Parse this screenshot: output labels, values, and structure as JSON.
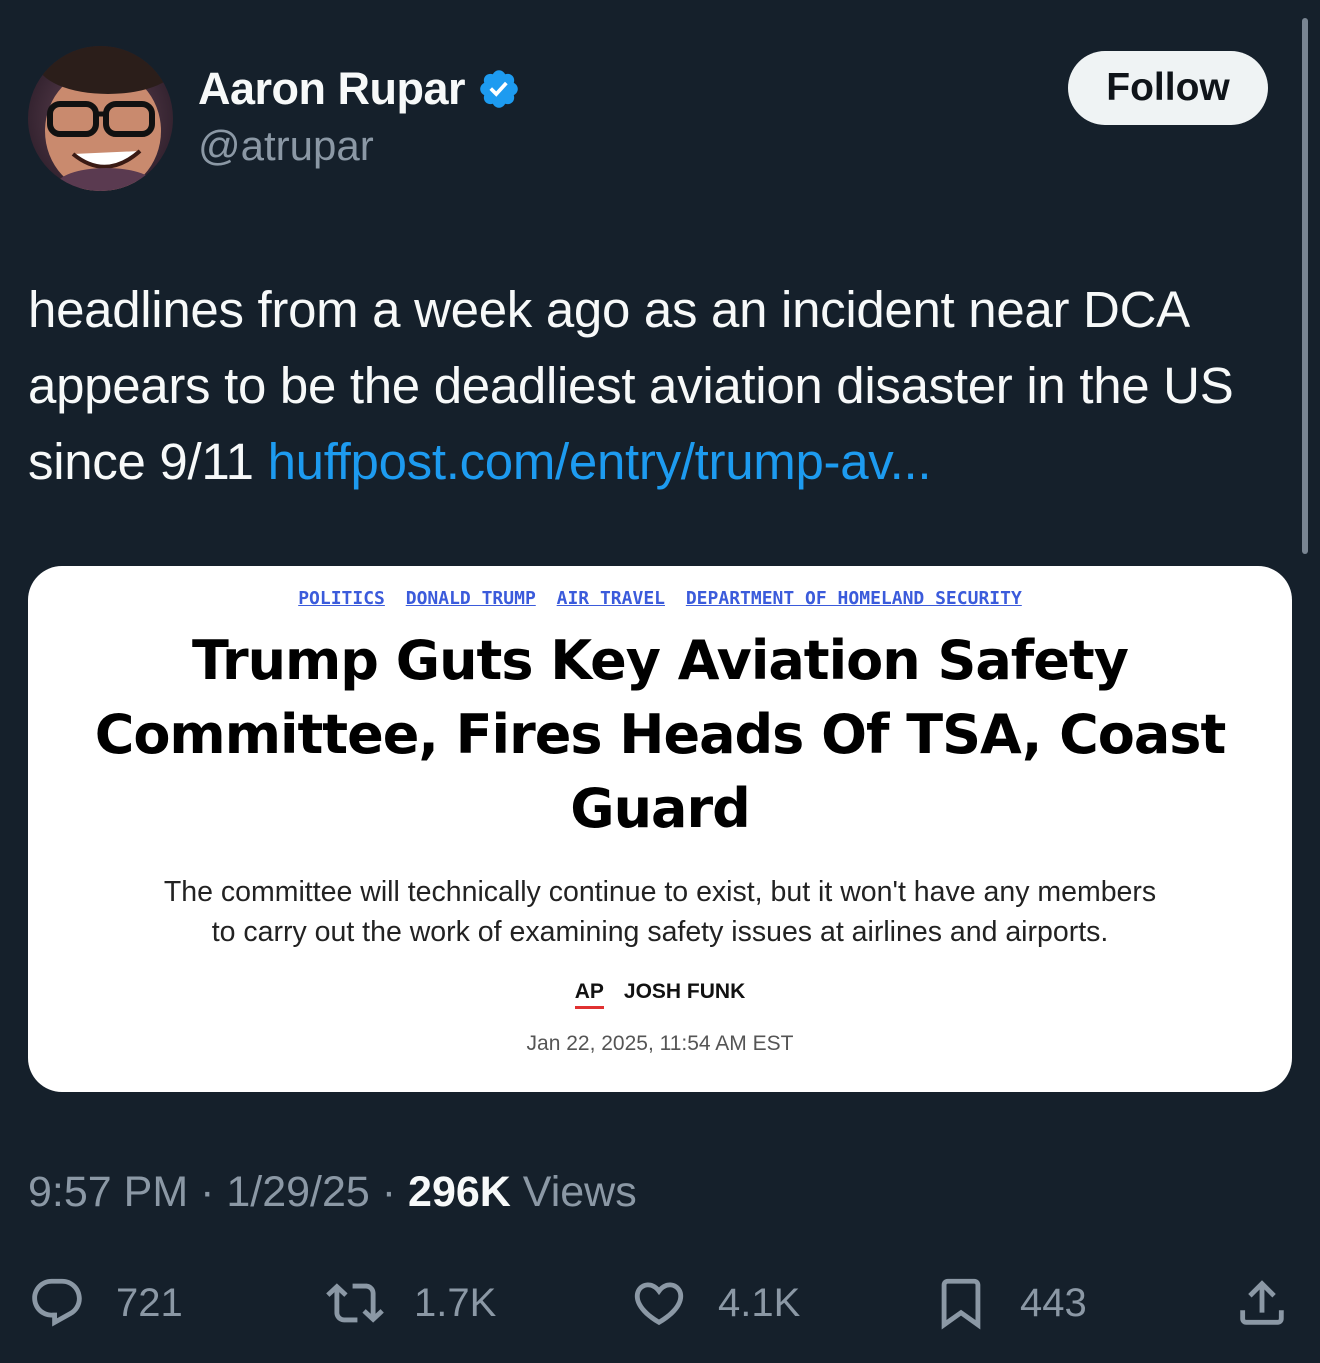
{
  "author": {
    "display_name": "Aaron Rupar",
    "handle": "@atrupar",
    "verified": true
  },
  "follow_button": {
    "label": "Follow"
  },
  "tweet": {
    "text": "headlines from a week ago as an incident near DCA appears to be the deadliest aviation disaster in the US since 9/11 ",
    "link_text": "huffpost.com/entry/trump-av..."
  },
  "card": {
    "tags": [
      "POLITICS",
      "DONALD TRUMP",
      "AIR TRAVEL",
      "DEPARTMENT OF HOMELAND SECURITY"
    ],
    "headline_line1": "Trump Guts Key Aviation Safety",
    "headline_line2": "Committee, Fires Heads Of TSA, Coast",
    "headline_line3": "Guard",
    "subhead_line1": "The committee will technically continue to exist, but it won't have any members",
    "subhead_line2": "to carry out the work of examining safety issues at airlines and airports.",
    "byline_outlet": "AP",
    "byline_author": "JOSH FUNK",
    "dateline": "Jan 22, 2025, 11:54 AM EST"
  },
  "meta": {
    "time": "9:57 PM",
    "separator": " · ",
    "date": "1/29/25",
    "views_count": "296K",
    "views_label": " Views"
  },
  "actions": {
    "replies": "721",
    "reposts": "1.7K",
    "likes": "4.1K",
    "bookmarks": "443"
  },
  "colors": {
    "background": "#15202b",
    "accent": "#1d9bf0",
    "secondary_text": "#8b98a5",
    "primary_text": "#f7f9f9"
  },
  "icons": [
    "verified-badge-icon",
    "reply-icon",
    "repost-icon",
    "like-icon",
    "bookmark-icon",
    "share-icon"
  ]
}
